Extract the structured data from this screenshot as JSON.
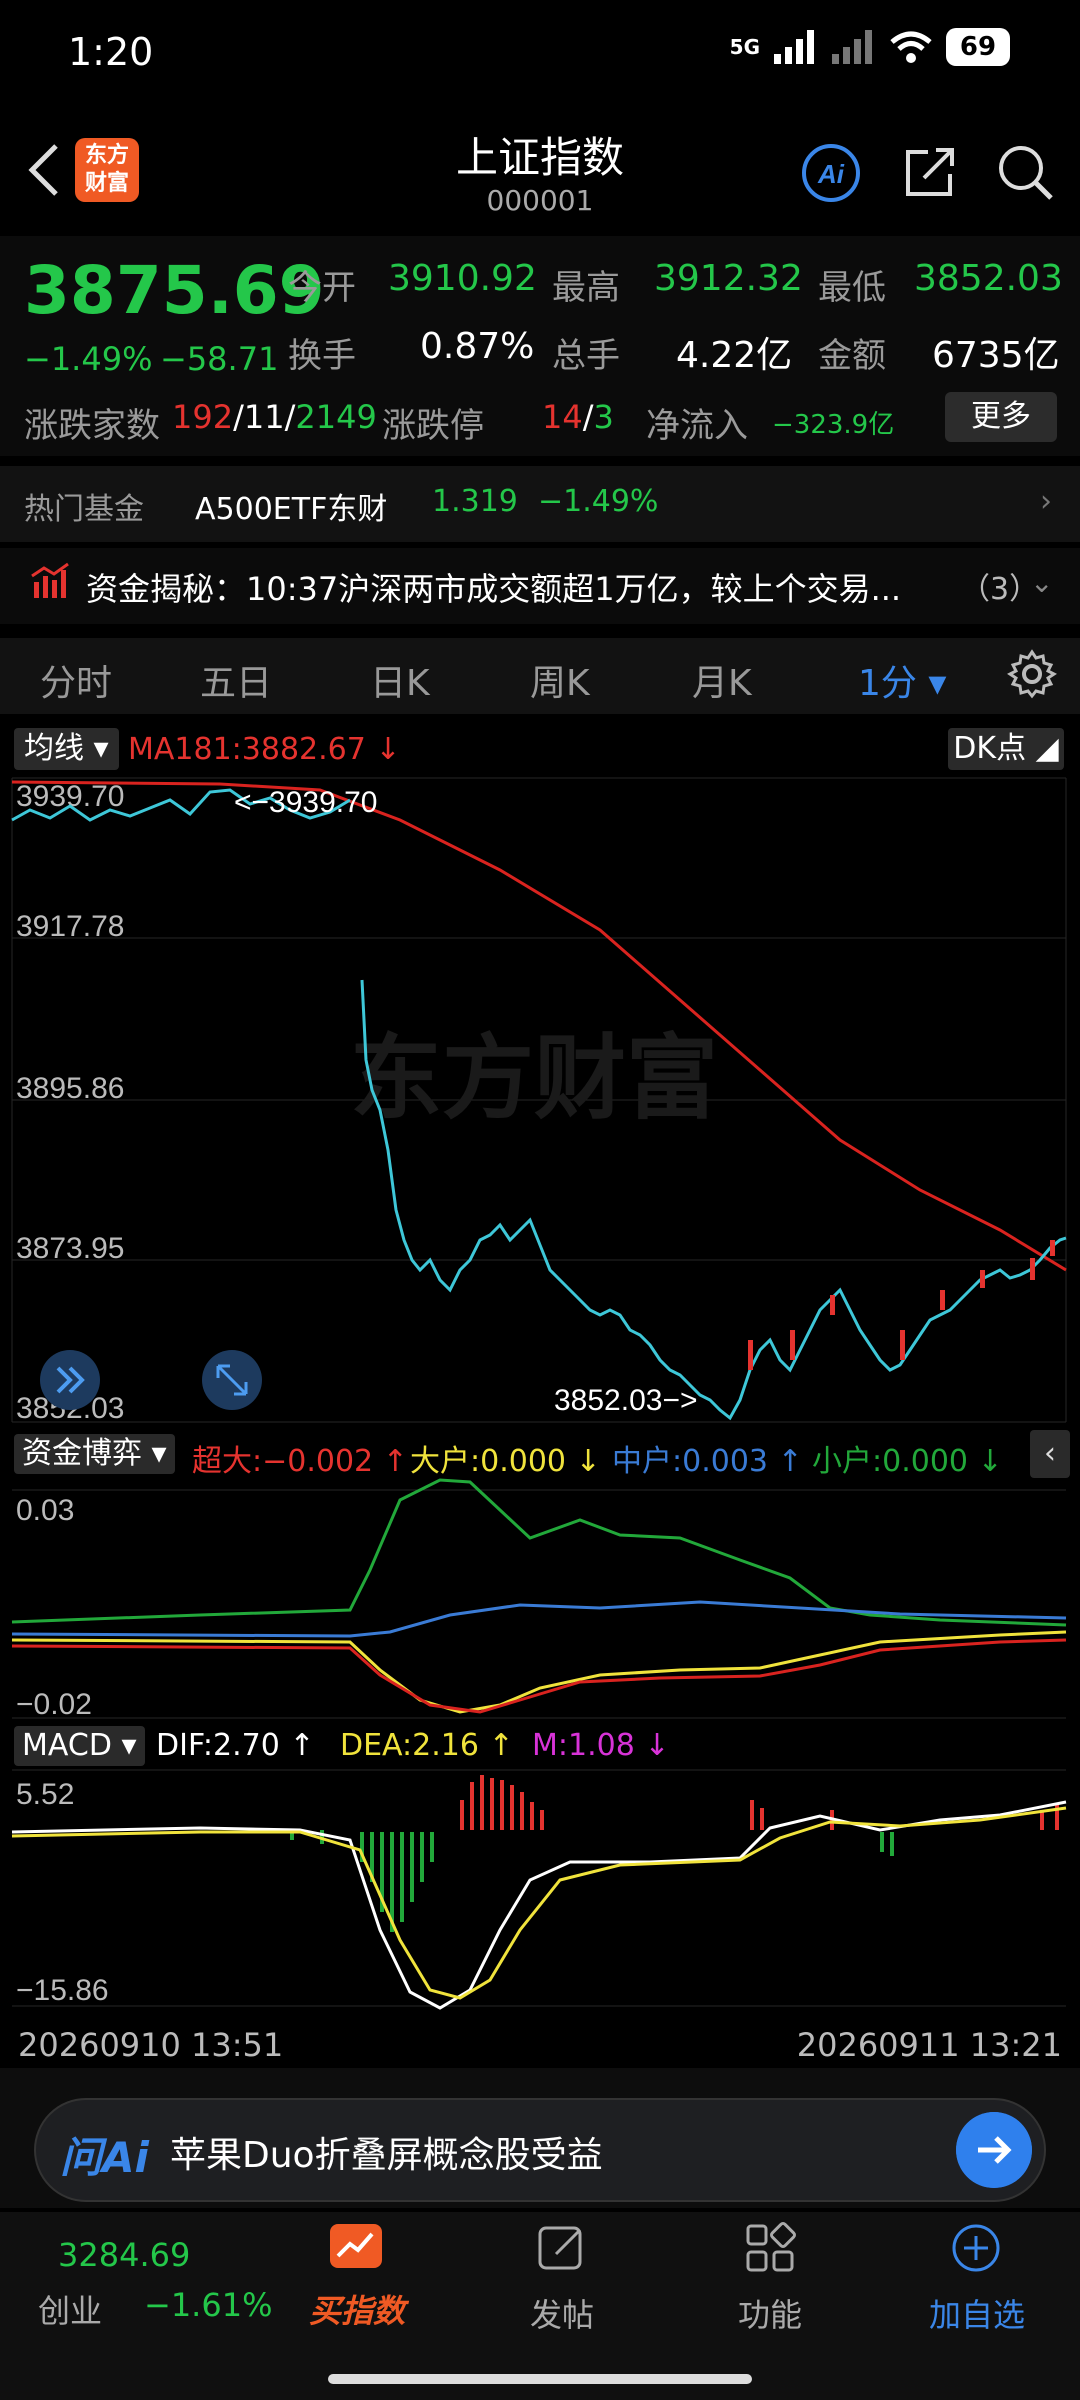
{
  "status": {
    "time": "1:20",
    "network": "5G",
    "battery": "69"
  },
  "header": {
    "title": "上证指数",
    "code": "000001",
    "logo_text": "东方\n财富"
  },
  "quote": {
    "price": "3875.69",
    "change_pct": "−1.49%",
    "change_abs": "−58.71",
    "open_label": "今开",
    "open": "3910.92",
    "high_label": "最高",
    "high": "3912.32",
    "low_label": "最低",
    "low": "3852.03",
    "turnover_label": "换手",
    "turnover": "0.87%",
    "volume_label": "总手",
    "volume": "4.22亿",
    "amount_label": "金额",
    "amount": "6735亿",
    "breadth_label": "涨跌家数",
    "up": "192",
    "flat": "11",
    "down": "2149",
    "limit_label": "涨跌停",
    "limit_up": "14",
    "limit_down": "3",
    "inflow_label": "净流入",
    "inflow": "−323.9亿",
    "more_label": "更多",
    "sep": "/"
  },
  "hot_fund": {
    "label": "热门基金",
    "name": "A500ETF东财",
    "price": "1.319",
    "change": "−1.49%"
  },
  "news": {
    "text": "资金揭秘：10:37沪深两市成交额超1万亿，较上个交易...",
    "count": "（3）"
  },
  "tabs": [
    {
      "label": "分时"
    },
    {
      "label": "五日"
    },
    {
      "label": "日K"
    },
    {
      "label": "周K"
    },
    {
      "label": "月K"
    },
    {
      "label": "1分 ▾"
    }
  ],
  "main_chart": {
    "ma_select": "均线",
    "ma_text": "MA181:3882.67 ↓",
    "dk_label": "DK点",
    "y_ticks": [
      "3939.70",
      "3917.78",
      "3895.86",
      "3873.95",
      "3852.03"
    ],
    "high_marker": "<−3939.70",
    "low_marker": "3852.03−>",
    "watermark": "东方财富"
  },
  "fund_panel": {
    "select": "资金博弈",
    "super": "超大:−0.002 ↑",
    "large": "大户:0.000 ↓",
    "medium": "中户:0.003 ↑",
    "small": "小户:0.000 ↓",
    "y_top": "0.03",
    "y_bottom": "−0.02"
  },
  "macd_panel": {
    "select": "MACD",
    "dif": "DIF:2.70 ↑",
    "dea": "DEA:2.16 ↑",
    "m": "M:1.08 ↓",
    "y_top": "5.52",
    "y_bottom": "−15.86"
  },
  "dates": {
    "start": "20260910 13:51",
    "end": "20260911 13:21"
  },
  "ask_ai": {
    "logo": "问Ai",
    "text": "苹果Duo折叠屏概念股受益"
  },
  "bottom_nav": {
    "index_price": "3284.69",
    "index_name": "创业",
    "index_change": "−1.61%",
    "items": [
      {
        "label": "买指数"
      },
      {
        "label": "发帖"
      },
      {
        "label": "功能"
      },
      {
        "label": "加自选"
      }
    ]
  },
  "colors": {
    "up": "#e5332f",
    "down": "#24c74a",
    "accent": "#3a86e8",
    "brand": "#f05a24"
  }
}
